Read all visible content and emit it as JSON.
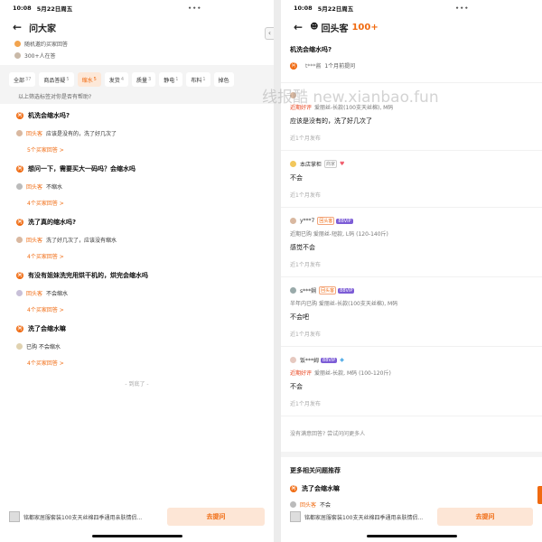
{
  "left": {
    "status_time": "10:08",
    "status_date": "5月22日周五",
    "status_dots": "•••",
    "title": "问大家",
    "invite_text": "随机邀约买家回答",
    "online_text": "300+人在答",
    "tabs": [
      {
        "label": "全部",
        "count": "37"
      },
      {
        "label": "商品答疑",
        "count": "5"
      },
      {
        "label": "缩水",
        "count": "5"
      },
      {
        "label": "发货",
        "count": "4"
      },
      {
        "label": "质量",
        "count": "3"
      },
      {
        "label": "静电",
        "count": "1"
      },
      {
        "label": "布料",
        "count": "1"
      },
      {
        "label": "掉色",
        "count": ""
      }
    ],
    "hint": "以上筛选标签对你是否有帮助?",
    "questions": [
      {
        "q": "机洗会缩水吗?",
        "tag": "回头客",
        "answer": "应该是没有的，洗了好几次了",
        "more": "5个买家回答 >"
      },
      {
        "q": "想问一下，需要买大一码吗？会缩水吗",
        "tag": "回头客",
        "answer": "不缩水",
        "more": "4个买家回答 >"
      },
      {
        "q": "洗了真的缩水吗?",
        "tag": "回头客",
        "answer": "洗了好几次了，应该没有缩水",
        "more": "4个买家回答 >"
      },
      {
        "q": "有没有姐妹洗完用烘干机的，烘完会缩水吗",
        "tag": "回头客",
        "answer": "不会缩水",
        "more": "4个买家回答 >"
      },
      {
        "q": "洗了会缩水嘛",
        "tag": "",
        "answer": "已购  不会缩水",
        "more": "4个买家回答 >"
      }
    ],
    "end_text": "- 到底了 -",
    "product_text": "铭都家居服套装100支天丝棉四季通用亲肤情侣...",
    "ask_button": "去提问"
  },
  "right": {
    "status_time": "10:08",
    "status_date": "5月22日周五",
    "status_dots": "•••",
    "title": "回头客",
    "title_tag": "100+",
    "question": "机洗会缩水吗?",
    "asker_name": "t***酱",
    "asker_time": "1个月前提问",
    "answers": [
      {
        "name": "",
        "tags": [],
        "purchase_flag": "近期好评",
        "purchase": "爱丽丝-长款(100支天丝棉), M码",
        "text": "应该是没有的，洗了好几次了",
        "time": "近1个月发布"
      },
      {
        "name": "本店掌柜",
        "tags": [
          "商家"
        ],
        "purchase_flag": "",
        "purchase": "",
        "text": "不会",
        "time": "近1个月发布"
      },
      {
        "name": "y***7",
        "tags": [
          "回头客",
          "88VIP"
        ],
        "purchase_flag": "",
        "purchase": "近期已购  爱丽丝-短款, L码 (120-140斤)",
        "text": "感觉不会",
        "time": "近1个月发布"
      },
      {
        "name": "s***娴",
        "tags": [
          "回头客",
          "88VIP"
        ],
        "purchase_flag": "",
        "purchase": "半年内已购  爱丽丝-长款(100支天丝棉), M码",
        "text": "不会吧",
        "time": "近1个月发布"
      },
      {
        "name": "饭***姆",
        "tags": [
          "88VIP"
        ],
        "purchase_flag": "近期好评",
        "purchase": "爱丽丝-长款, M码 (100-120斤)",
        "text": "不会",
        "time": "近1个月发布"
      }
    ],
    "no_fit": "没有满意回答? 尝试问问更多人",
    "more_rec": "更多相关问题推荐",
    "rec_q": "洗了会缩水嘛",
    "rec_tag": "回头客",
    "rec_answer": "不会",
    "product_text": "铭都家居服套装100支天丝棉四季通用亲肤情侣...",
    "ask_button": "去提问"
  },
  "watermark": "线报酷 new.xianbao.fun"
}
